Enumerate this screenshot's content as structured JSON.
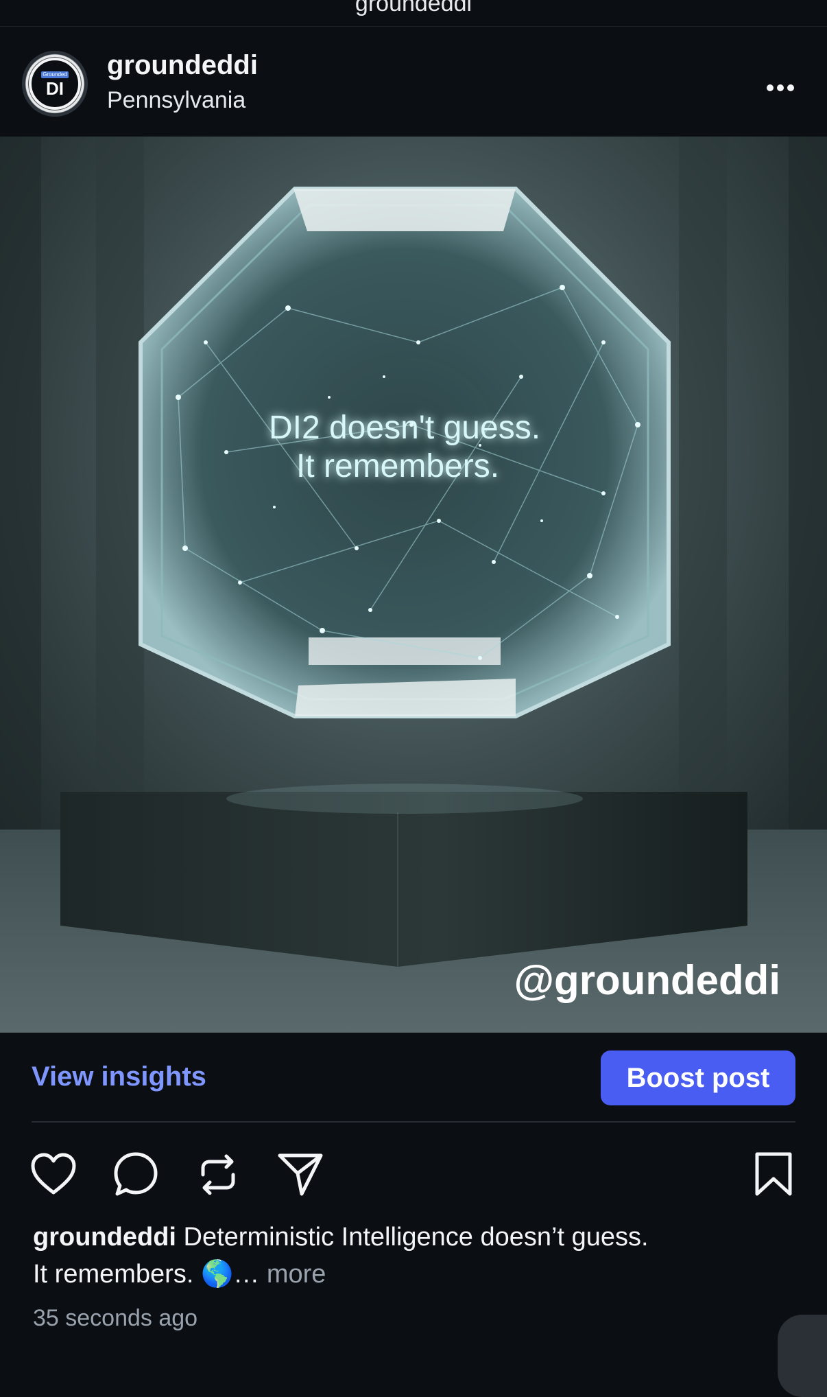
{
  "topbar": {
    "title": "groundeddi"
  },
  "header": {
    "username": "groundeddi",
    "location": "Pennsylvania",
    "avatar": {
      "badge_text": "Grounded",
      "monogram": "DI"
    },
    "more_icon": "more-horizontal-icon"
  },
  "post_image": {
    "headline_line1": "DI2 doesn't guess.",
    "headline_line2": "It remembers.",
    "watermark": "@groundeddi"
  },
  "insights": {
    "view_label": "View insights",
    "boost_label": "Boost post",
    "accent_color": "#7f96ff",
    "button_color": "#4a5df2"
  },
  "actions": {
    "icons": [
      "heart-icon",
      "comment-icon",
      "repost-icon",
      "send-icon",
      "bookmark-icon"
    ]
  },
  "caption": {
    "username": "groundeddi",
    "text_line1": " Deterministic Intelligence doesn’t guess.",
    "text_line2": "It remembers. ",
    "emoji": "🌎",
    "ellipsis": "… ",
    "more_label": "more"
  },
  "timestamp": "35 seconds ago"
}
